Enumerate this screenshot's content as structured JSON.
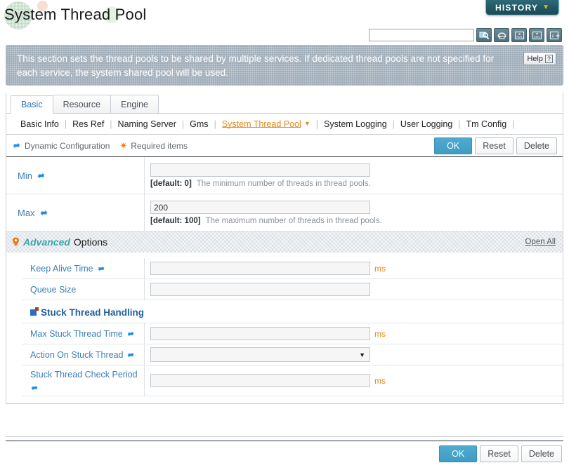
{
  "header": {
    "title": "System Thread Pool",
    "history_label": "HISTORY",
    "history_caret": "▼"
  },
  "search": {
    "value": "",
    "placeholder": "",
    "icons": [
      {
        "name": "search-icon",
        "title": "Search"
      },
      {
        "name": "refresh-icon",
        "title": "Refresh"
      },
      {
        "name": "xml-import-icon",
        "title": "Import XML"
      },
      {
        "name": "xml-export-icon",
        "title": "Export XML"
      },
      {
        "name": "save-xml-icon",
        "title": "Save"
      }
    ]
  },
  "banner": {
    "text": "This section sets the thread pools to be shared by multiple services. If dedicated thread pools are not specified for each service, the system shared pool will be used.",
    "help_label": "Help",
    "help_mark": "?"
  },
  "tabs": [
    {
      "label": "Basic",
      "active": true
    },
    {
      "label": "Resource",
      "active": false
    },
    {
      "label": "Engine",
      "active": false
    }
  ],
  "subnav": [
    {
      "label": "Basic Info",
      "active": false
    },
    {
      "label": "Res Ref",
      "active": false
    },
    {
      "label": "Naming Server",
      "active": false
    },
    {
      "label": "Gms",
      "active": false
    },
    {
      "label": "System Thread Pool",
      "active": true,
      "caret": "▼"
    },
    {
      "label": "System Logging",
      "active": false
    },
    {
      "label": "User Logging",
      "active": false
    },
    {
      "label": "Tm Config",
      "active": false
    }
  ],
  "subnav_separator": "|",
  "actionbar": {
    "dynamic_label": "Dynamic Configuration",
    "required_label": "Required items",
    "required_mark": "✷",
    "buttons": {
      "ok": "OK",
      "reset": "Reset",
      "delete": "Delete"
    }
  },
  "basic_fields": [
    {
      "label": "Min",
      "dynamic": true,
      "value": "",
      "default_text": "[default: 0]",
      "description": "The minimum number of threads in thread pools."
    },
    {
      "label": "Max",
      "dynamic": true,
      "value": "200",
      "default_text": "[default: 100]",
      "description": "The maximum number of threads in thread pools."
    }
  ],
  "advanced": {
    "title_emphasis": "Advanced",
    "title_rest": "Options",
    "open_all": "Open All",
    "rows": [
      {
        "type": "text",
        "label": "Keep Alive Time",
        "dynamic": true,
        "value": "",
        "unit": "ms"
      },
      {
        "type": "text",
        "label": "Queue Size",
        "dynamic": false,
        "value": "",
        "unit": ""
      },
      {
        "type": "section",
        "label": "Stuck Thread Handling"
      },
      {
        "type": "text",
        "label": "Max Stuck Thread Time",
        "dynamic": true,
        "value": "",
        "unit": "ms"
      },
      {
        "type": "select",
        "label": "Action On Stuck Thread",
        "dynamic": true,
        "value": "",
        "unit": "",
        "arrow": "▼"
      },
      {
        "type": "text",
        "label": "Stuck Thread Check Period",
        "dynamic": true,
        "value": "",
        "unit": "ms"
      }
    ]
  },
  "footer": {
    "buttons": {
      "ok": "OK",
      "reset": "Reset",
      "delete": "Delete"
    }
  }
}
